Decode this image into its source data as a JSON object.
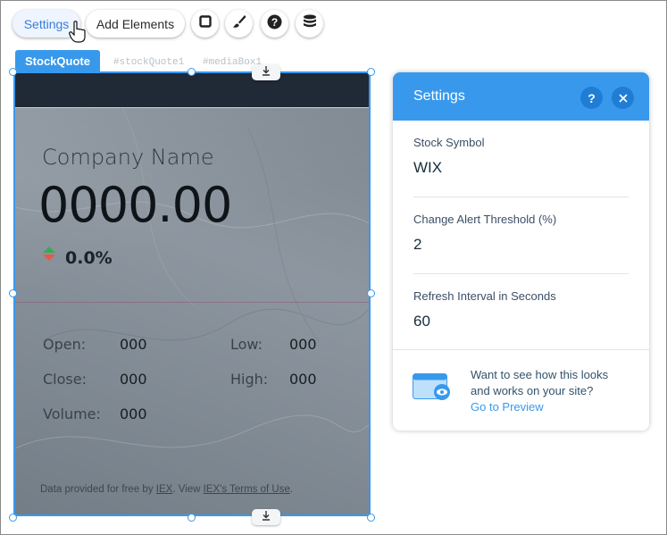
{
  "toolbar": {
    "settings_label": "Settings",
    "add_elements_label": "Add Elements",
    "icons": [
      "square-icon",
      "paintbrush-icon",
      "help-icon",
      "database-icon"
    ]
  },
  "widget": {
    "tag_label": "StockQuote",
    "ids": [
      "#stockQuote1",
      "#mediaBox1"
    ],
    "company_name": "Company Name",
    "price": "0000.00",
    "change": "0.0%",
    "stats": [
      {
        "label": "Open:",
        "value": "000"
      },
      {
        "label": "Close:",
        "value": "000"
      },
      {
        "label": "Volume:",
        "value": "000"
      },
      {
        "label": "Low:",
        "value": "000"
      },
      {
        "label": "High:",
        "value": "000"
      }
    ],
    "footer": {
      "prefix": "Data provided for free by",
      "link1": "IEX",
      "middle": ". View",
      "link2": "IEX's Terms of Use",
      "suffix": "."
    }
  },
  "panel": {
    "title": "Settings",
    "fields": [
      {
        "label": "Stock Symbol",
        "value": "WIX"
      },
      {
        "label": "Change Alert Threshold (%)",
        "value": "2"
      },
      {
        "label": "Refresh Interval in Seconds",
        "value": "60"
      }
    ],
    "preview_line1": "Want to see how this looks",
    "preview_line2": "and works on your site?",
    "preview_link": "Go to Preview"
  },
  "colors": {
    "accent": "#3899ec",
    "widget_header": "#1f2a36"
  }
}
